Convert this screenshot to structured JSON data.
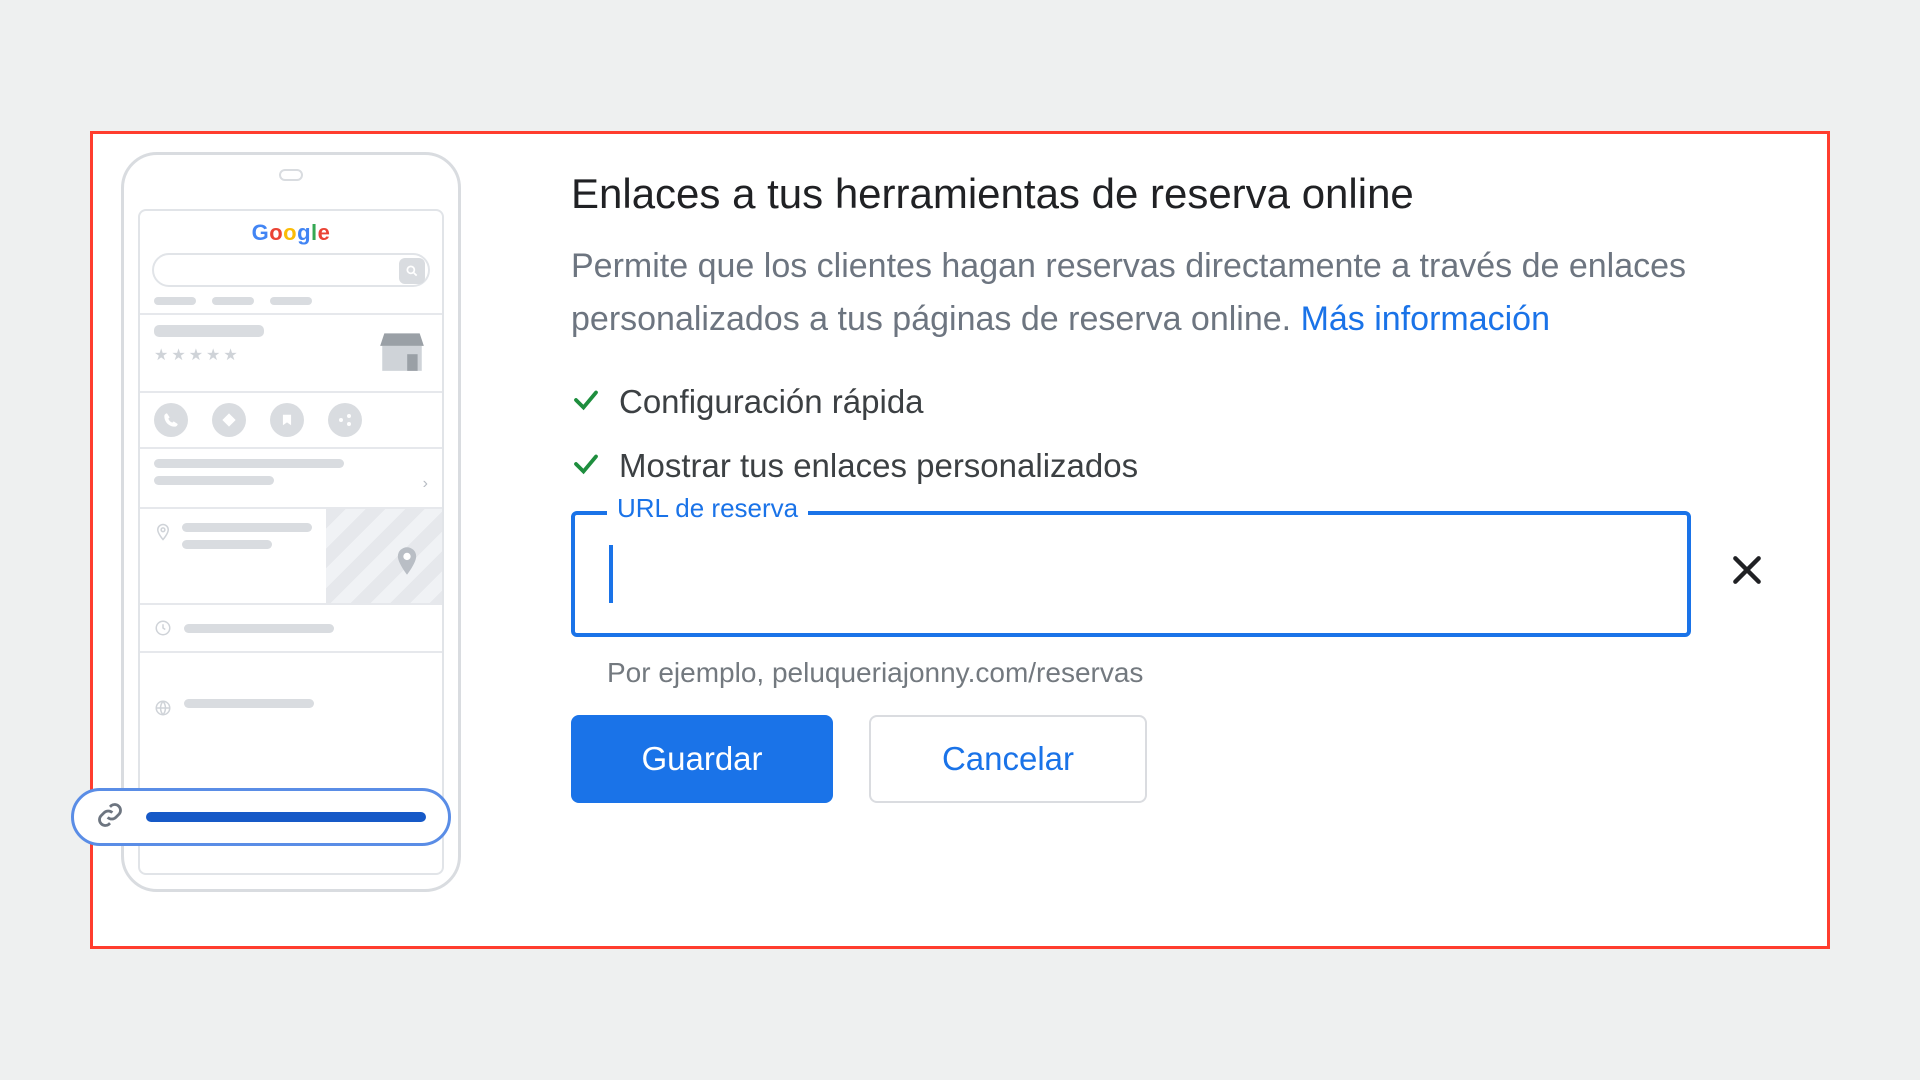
{
  "illustration": {
    "logo_letters": [
      "G",
      "o",
      "o",
      "g",
      "l",
      "e"
    ]
  },
  "heading": "Enlaces a tus herramientas de reserva online",
  "description_text": "Permite que los clientes hagan reservas directamente a través de enlaces personalizados a tus páginas de reserva online. ",
  "description_link": "Más información",
  "checks": {
    "item1": "Configuración rápida",
    "item2": "Mostrar tus enlaces personalizados"
  },
  "field": {
    "label": "URL de reserva",
    "value": "",
    "hint": "Por ejemplo, peluqueriajonny.com/reservas"
  },
  "buttons": {
    "save": "Guardar",
    "cancel": "Cancelar"
  }
}
